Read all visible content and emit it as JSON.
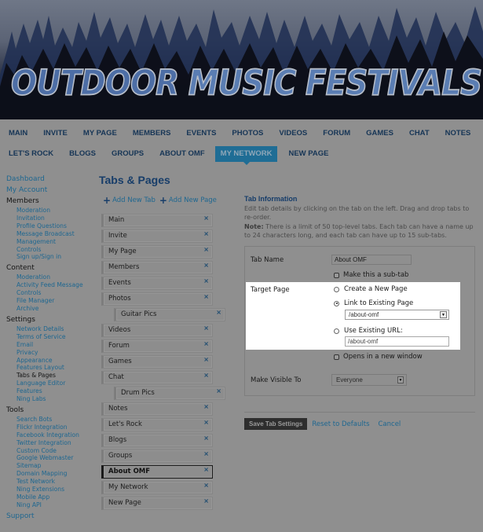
{
  "banner": {
    "title_word1": "OUTDOOR",
    "title_word2": "MUSIC",
    "title_word3": "FESTIVALS"
  },
  "nav": {
    "row1": [
      "MAIN",
      "INVITE",
      "MY PAGE",
      "MEMBERS",
      "EVENTS",
      "PHOTOS",
      "VIDEOS",
      "FORUM",
      "GAMES",
      "CHAT",
      "NOTES"
    ],
    "row2": [
      "LET'S ROCK",
      "BLOGS",
      "GROUPS",
      "ABOUT OMF",
      "MY NETWORK",
      "NEW PAGE"
    ],
    "active": "MY NETWORK",
    "accent_color": "#1f6d95"
  },
  "sidebar": {
    "top_links": [
      "Dashboard",
      "My Account"
    ],
    "groups": [
      {
        "heading": "Members",
        "items": [
          "Moderation",
          "Invitation",
          "Profile Questions",
          "Message Broadcast",
          "Management",
          "Controls",
          "Sign up/Sign in"
        ]
      },
      {
        "heading": "Content",
        "items": [
          "Moderation",
          "Activity Feed Message",
          "Controls",
          "File Manager",
          "Archive"
        ]
      },
      {
        "heading": "Settings",
        "items": [
          "Network Details",
          "Terms of Service",
          "Email",
          "Privacy",
          "Appearance",
          "Features Layout",
          "Tabs & Pages",
          "Language Editor",
          "Features",
          "Ning Labs"
        ]
      },
      {
        "heading": "Tools",
        "items": [
          "Search Bots",
          "Flickr Integration",
          "Facebook Integration",
          "Twitter Integration",
          "Custom Code",
          "Google Webmaster",
          "Sitemap",
          "Domain Mapping",
          "Test Network",
          "Ning Extensions",
          "Mobile App",
          "Ning API"
        ]
      }
    ],
    "current": "Tabs & Pages",
    "bottom_link": "Support"
  },
  "main": {
    "title": "Tabs & Pages",
    "add_tab": "Add New Tab",
    "add_page": "Add New Page",
    "tabs": [
      {
        "label": "Main",
        "sub": false
      },
      {
        "label": "Invite",
        "sub": false
      },
      {
        "label": "My Page",
        "sub": false
      },
      {
        "label": "Members",
        "sub": false
      },
      {
        "label": "Events",
        "sub": false
      },
      {
        "label": "Photos",
        "sub": false
      },
      {
        "label": "Guitar Pics",
        "sub": true
      },
      {
        "label": "Videos",
        "sub": false
      },
      {
        "label": "Forum",
        "sub": false
      },
      {
        "label": "Games",
        "sub": false
      },
      {
        "label": "Chat",
        "sub": false
      },
      {
        "label": "Drum Pics",
        "sub": true
      },
      {
        "label": "Notes",
        "sub": false
      },
      {
        "label": "Let's Rock",
        "sub": false
      },
      {
        "label": "Blogs",
        "sub": false
      },
      {
        "label": "Groups",
        "sub": false
      },
      {
        "label": "About OMF",
        "sub": false,
        "selected": true
      },
      {
        "label": "My Network",
        "sub": false
      },
      {
        "label": "New Page",
        "sub": false
      }
    ],
    "remove_glyph": "×"
  },
  "tab_info": {
    "title": "Tab Information",
    "description": "Edit tab details by clicking on the tab on the left. Drag and drop tabs to re-order.",
    "note_label": "Note:",
    "note_text": " There is a limit of 50 top-level tabs. Each tab can have a name up to 24 characters long, and each tab can have up to 15 sub-tabs.",
    "tab_name_label": "Tab Name",
    "tab_name_value": "About OMF",
    "sub_tab_label": "Make this a sub-tab",
    "sub_tab_checked": false,
    "target_page_label": "Target Page",
    "radio_create": "Create a New Page",
    "radio_link": "Link to Existing Page",
    "radio_url": "Use Existing URL:",
    "selected_radio": "Link to Existing Page",
    "existing_page_value": "/about-omf",
    "url_value": "/about-omf",
    "new_window_label": "Opens in a new window",
    "new_window_checked": false,
    "visible_label": "Make Visible To",
    "visible_value": "Everyone",
    "select_arrow": "▼"
  },
  "actions": {
    "save": "Save Tab Settings",
    "reset": "Reset to Defaults",
    "cancel": "Cancel"
  }
}
